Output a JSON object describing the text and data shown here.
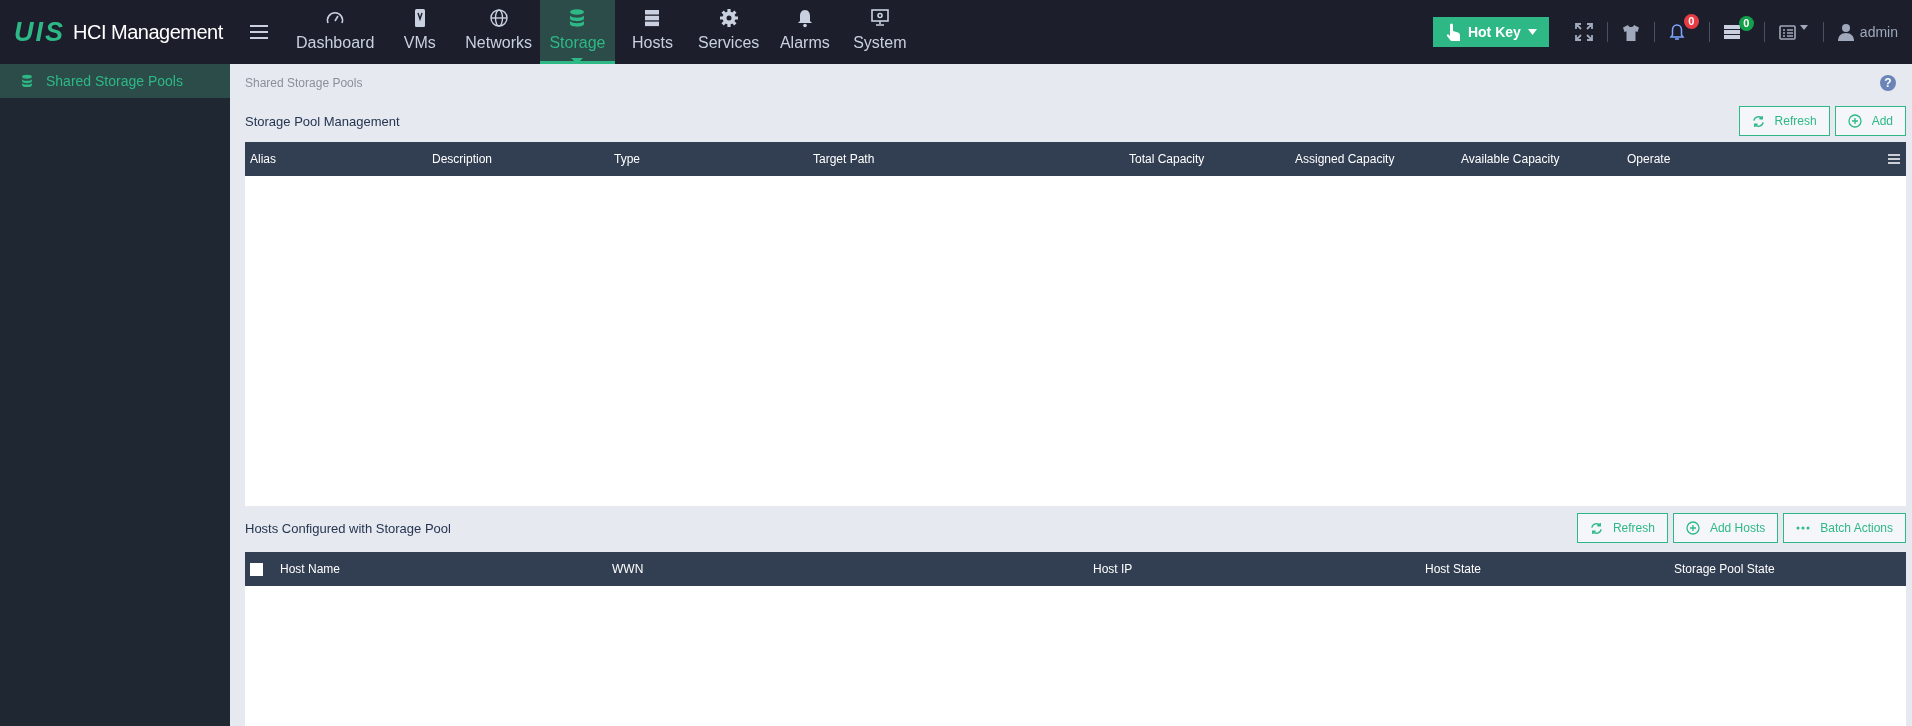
{
  "brand": {
    "mark": "UIS",
    "title": "HCI Management"
  },
  "nav": [
    {
      "label": "Dashboard",
      "selected": false
    },
    {
      "label": "VMs",
      "selected": false
    },
    {
      "label": "Networks",
      "selected": false
    },
    {
      "label": "Storage",
      "selected": true
    },
    {
      "label": "Hosts",
      "selected": false
    },
    {
      "label": "Services",
      "selected": false
    },
    {
      "label": "Alarms",
      "selected": false
    },
    {
      "label": "System",
      "selected": false
    }
  ],
  "help": "?",
  "hotkey": {
    "label": "Hot Key"
  },
  "alarm_count": "0",
  "task_count": "0",
  "user": "admin",
  "sidebar": {
    "items": [
      {
        "label": "Shared Storage Pools",
        "selected": true
      }
    ]
  },
  "breadcrumb": "Shared Storage Pools",
  "pools": {
    "title": "Storage Pool Management",
    "buttons": [
      {
        "label": "Refresh",
        "kind": "refresh"
      },
      {
        "label": "Add",
        "kind": "add"
      }
    ],
    "columns": [
      "Alias",
      "Description",
      "Type",
      "Target Path",
      "Total Capacity",
      "Assigned Capacity",
      "Available Capacity",
      "Operate"
    ]
  },
  "hosts": {
    "title": "Hosts Configured with Storage Pool",
    "buttons": [
      {
        "label": "Refresh",
        "kind": "refresh"
      },
      {
        "label": "Add Hosts",
        "kind": "add"
      },
      {
        "label": "Batch Actions",
        "kind": "more"
      }
    ],
    "select_all": {
      "checked": false
    },
    "columns": [
      "Host Name",
      "WWN",
      "Host IP",
      "Host State",
      "Storage Pool State"
    ]
  }
}
